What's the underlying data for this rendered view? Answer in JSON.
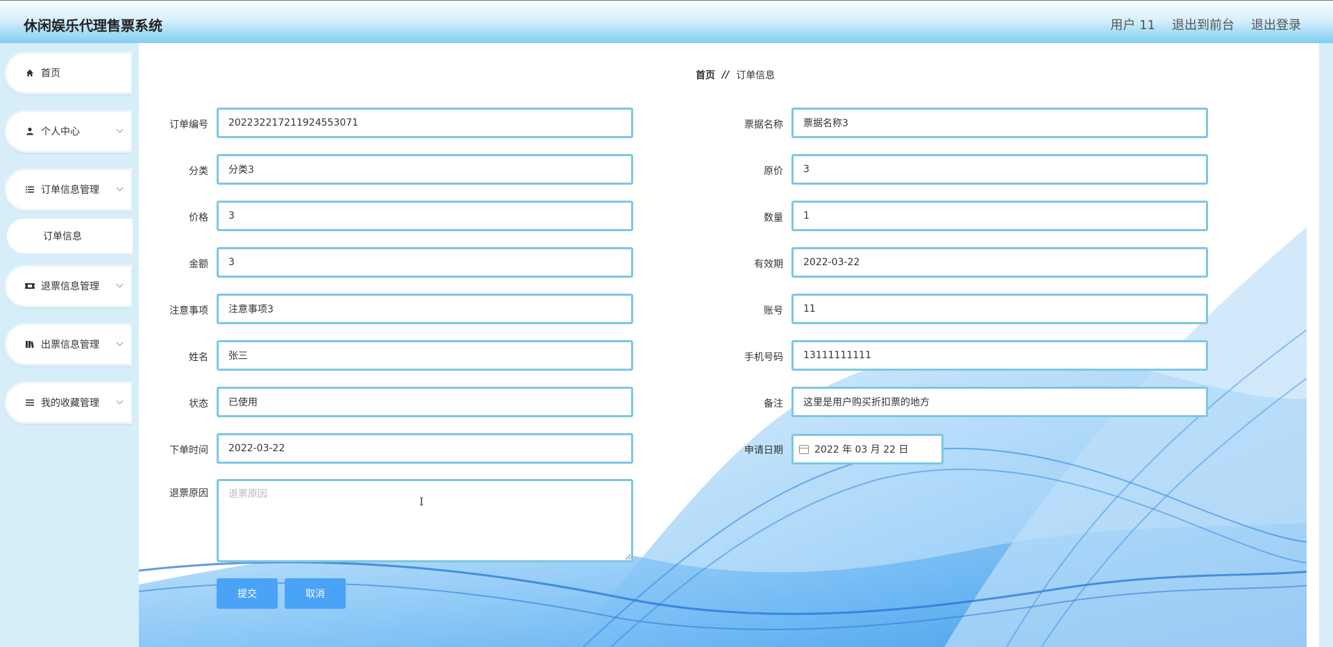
{
  "header": {
    "title": "休闲娱乐代理售票系统",
    "user": "用户 11",
    "back_to_front": "退出到前台",
    "logout": "退出登录"
  },
  "sidebar": {
    "items": [
      {
        "label": "首页",
        "icon": "home-icon"
      },
      {
        "label": "个人中心",
        "icon": "user-icon"
      },
      {
        "label": "订单信息管理",
        "icon": "list-icon"
      },
      {
        "label": "订单信息",
        "icon": ""
      },
      {
        "label": "退票信息管理",
        "icon": "ticket-icon"
      },
      {
        "label": "出票信息管理",
        "icon": "book-icon"
      },
      {
        "label": "我的收藏管理",
        "icon": "menu-icon"
      }
    ]
  },
  "breadcrumb": {
    "home": "首页",
    "separator": "//",
    "current": "订单信息"
  },
  "form": {
    "left": [
      {
        "label": "订单编号",
        "value": "20223221721192455307​1"
      },
      {
        "label": "分类",
        "value": "分类3"
      },
      {
        "label": "价格",
        "value": "3"
      },
      {
        "label": "金额",
        "value": "3"
      },
      {
        "label": "注意事项",
        "value": "注意事项3"
      },
      {
        "label": "姓名",
        "value": "张三"
      },
      {
        "label": "状态",
        "value": "已使用"
      },
      {
        "label": "下单时间",
        "value": "2022-03-22"
      }
    ],
    "right": [
      {
        "label": "票据名称",
        "value": "票据名称3"
      },
      {
        "label": "原价",
        "value": "3"
      },
      {
        "label": "数量",
        "value": "1"
      },
      {
        "label": "有效期",
        "value": "2022-03-22"
      },
      {
        "label": "账号",
        "value": "11"
      },
      {
        "label": "手机号码",
        "value": "13111111111"
      },
      {
        "label": "备注",
        "value": "这里是用户购买折扣票的地方"
      }
    ],
    "apply_date": {
      "label": "申请日期",
      "value": "2022 年 03 月 22 日"
    },
    "refund_reason": {
      "label": "退票原因",
      "placeholder": "退票原因",
      "value": ""
    },
    "submit": "提交",
    "cancel": "取消"
  },
  "colors": {
    "accent": "#4aa3f7",
    "input_border": "#7bc7e3",
    "sidebar_bg": "#d6eef8"
  }
}
